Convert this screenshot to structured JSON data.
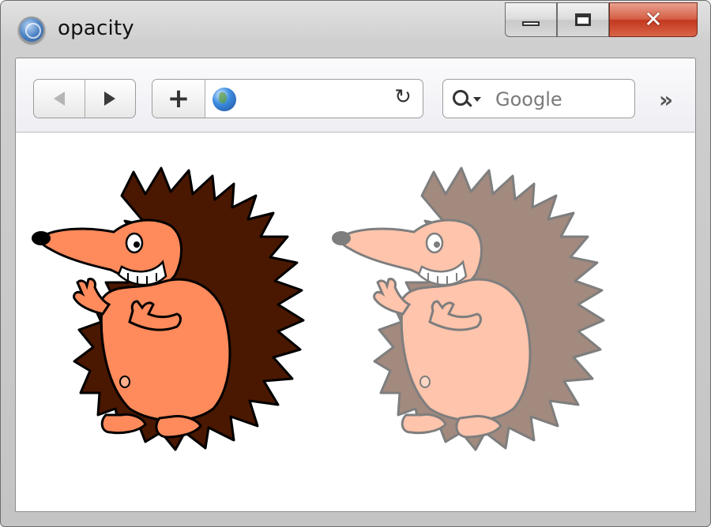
{
  "window": {
    "title": "opacity",
    "icons": {
      "app": "safari-compass-icon",
      "minimize": "minimize-icon",
      "maximize": "maximize-icon",
      "close": "close-icon"
    }
  },
  "toolbar": {
    "back_icon": "back-arrow-icon",
    "forward_icon": "forward-arrow-icon",
    "add_icon": "plus-icon",
    "add_label": "+",
    "site_icon": "globe-icon",
    "address_value": "",
    "reload_label": "↻",
    "search_placeholder": "Google",
    "search_value": "",
    "overflow_label": "»"
  },
  "content": {
    "images": [
      {
        "name": "hedgehog",
        "opacity": 1.0
      },
      {
        "name": "hedgehog",
        "opacity": 0.5
      }
    ]
  },
  "colors": {
    "spines": "#4a1700",
    "body": "#ff8a5c",
    "outline": "#000000",
    "close_button": "#c94a2e"
  }
}
